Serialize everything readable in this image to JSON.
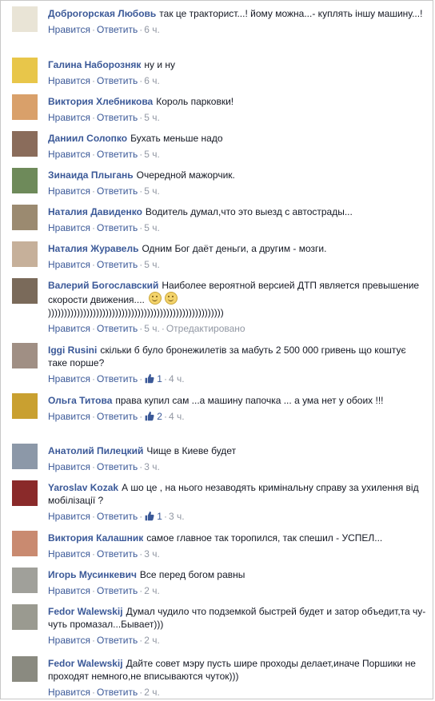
{
  "actions": {
    "like": "Нравится",
    "reply": "Ответить",
    "edited": "Отредактировано"
  },
  "comments": [
    {
      "author": "Доброгорская Любовь",
      "text": "так це тракторист...! йому можна...- куплять іншу машину...!",
      "time": "6 ч."
    },
    {
      "author": "Галина Наборозняк",
      "text": "ну и ну",
      "time": "6 ч."
    },
    {
      "author": "Виктория Хлебникова",
      "text": "Король парковки!",
      "time": "5 ч."
    },
    {
      "author": "Даниил Солопко",
      "text": "Бухать меньше надо",
      "time": "5 ч."
    },
    {
      "author": "Зинаида Плыгань",
      "text": "Очередной мажорчик.",
      "time": "5 ч."
    },
    {
      "author": "Наталия Давиденко",
      "text": "Водитель думал,что это выезд с автострады...",
      "time": "5 ч."
    },
    {
      "author": "Наталия Журавель",
      "text": "Одним Бог даёт деньги, а другим - мозги.",
      "time": "5 ч."
    },
    {
      "author": "Валерий Богославский",
      "text": "Наиболее вероятной версией ДТП является превышение скорости движения....",
      "text2": ")))))))))))))))))))))))))))))))))))))))))))))))))))))))",
      "time": "5 ч."
    },
    {
      "author": "Iggi Rusini",
      "text": "скільки б було бронежилетів за мабуть 2 500 000 гривень що коштує таке порше?",
      "likes": "1",
      "time": "4 ч."
    },
    {
      "author": "Ольга Титова",
      "text": "права купил сам ...а машину папочка ... а ума нет у обоих !!!",
      "likes": "2",
      "time": "4 ч."
    },
    {
      "author": "Анатолий Пилецкий",
      "text": "Чище в Киеве будет",
      "time": "3 ч."
    },
    {
      "author": "Yaroslav Kozak",
      "text": "А шо це , на нього незаводять кримінальну справу за ухилення від мобілізації ?",
      "likes": "1",
      "time": "3 ч."
    },
    {
      "author": "Виктория Калашник",
      "text": "самое главное так торопился, так спешил - УСПЕЛ...",
      "time": "3 ч."
    },
    {
      "author": "Игорь Мусинкевич",
      "text": "Все перед богом равны",
      "time": "2 ч."
    },
    {
      "author": "Fedor Walewskij",
      "text": "Думал чудило что подземкой быстрей будет и затор объедит,та чу-чуть промазал...Бывает)))",
      "time": "2 ч."
    },
    {
      "author": "Fedor Walewskij",
      "text": "Дайте совет мэру пусть шире проходы делает,иначе Поршики не проходят немного,не вписываются чуток)))",
      "time": "2 ч."
    }
  ],
  "avatar_colors": [
    "#e9e4d6",
    "#e8c64a",
    "#d9a06a",
    "#8a6c5b",
    "#6e8a5a",
    "#9b8a70",
    "#c6b09a",
    "#7a6a5a",
    "#a08f84",
    "#c9a030",
    "#8c98a8",
    "#8a2a2a",
    "#c98a70",
    "#a0a09a",
    "#9a9a90",
    "#8a8a80"
  ]
}
